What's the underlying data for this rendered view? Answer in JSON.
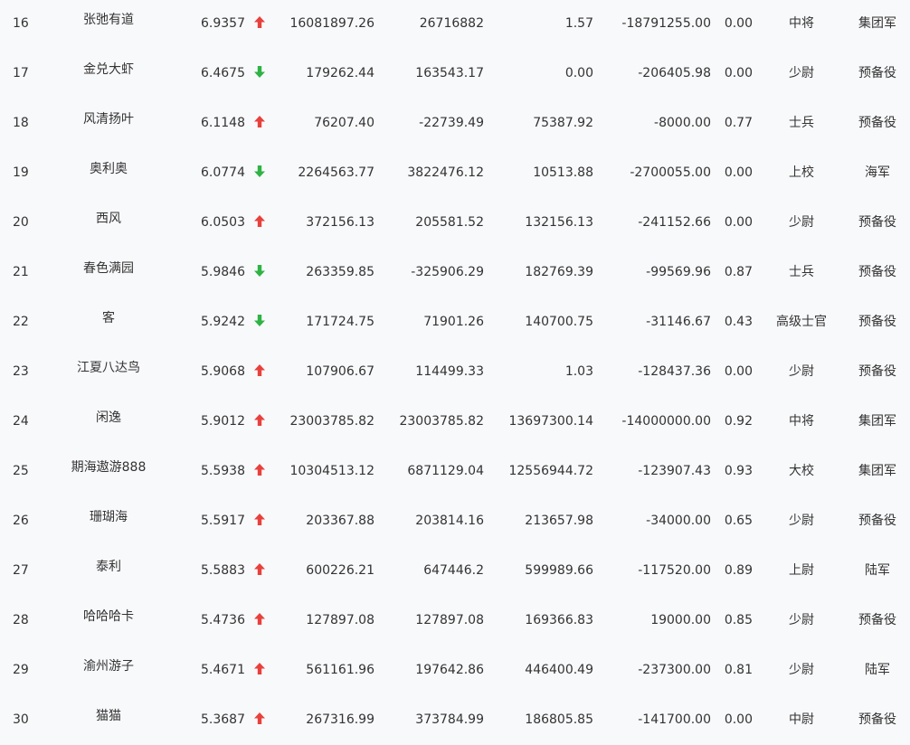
{
  "colors": {
    "up": "#e8413c",
    "down": "#2fb344",
    "text": "#333333",
    "background": "#f8f9fb"
  },
  "rows": [
    {
      "rank": "16",
      "name": "张弛有道",
      "score": "6.9357",
      "trend": "up",
      "trend_icon": "arrow-up-icon",
      "v1": "16081897.26",
      "v2": "26716882",
      "v3": "1.57",
      "v4": "-18791255.00",
      "ratio": "0.00",
      "rank_title": "中将",
      "branch": "集团军"
    },
    {
      "rank": "17",
      "name": "金兑大虾",
      "score": "6.4675",
      "trend": "down",
      "trend_icon": "arrow-down-icon",
      "v1": "179262.44",
      "v2": "163543.17",
      "v3": "0.00",
      "v4": "-206405.98",
      "ratio": "0.00",
      "rank_title": "少尉",
      "branch": "预备役"
    },
    {
      "rank": "18",
      "name": "风清扬叶",
      "score": "6.1148",
      "trend": "up",
      "trend_icon": "arrow-up-icon",
      "v1": "76207.40",
      "v2": "-22739.49",
      "v3": "75387.92",
      "v4": "-8000.00",
      "ratio": "0.77",
      "rank_title": "士兵",
      "branch": "预备役"
    },
    {
      "rank": "19",
      "name": "奥利奥",
      "score": "6.0774",
      "trend": "down",
      "trend_icon": "arrow-down-icon",
      "v1": "2264563.77",
      "v2": "3822476.12",
      "v3": "10513.88",
      "v4": "-2700055.00",
      "ratio": "0.00",
      "rank_title": "上校",
      "branch": "海军"
    },
    {
      "rank": "20",
      "name": "西风",
      "score": "6.0503",
      "trend": "up",
      "trend_icon": "arrow-up-icon",
      "v1": "372156.13",
      "v2": "205581.52",
      "v3": "132156.13",
      "v4": "-241152.66",
      "ratio": "0.00",
      "rank_title": "少尉",
      "branch": "预备役"
    },
    {
      "rank": "21",
      "name": "春色满园",
      "score": "5.9846",
      "trend": "down",
      "trend_icon": "arrow-down-icon",
      "v1": "263359.85",
      "v2": "-325906.29",
      "v3": "182769.39",
      "v4": "-99569.96",
      "ratio": "0.87",
      "rank_title": "士兵",
      "branch": "预备役"
    },
    {
      "rank": "22",
      "name": "客",
      "score": "5.9242",
      "trend": "down",
      "trend_icon": "arrow-down-icon",
      "v1": "171724.75",
      "v2": "71901.26",
      "v3": "140700.75",
      "v4": "-31146.67",
      "ratio": "0.43",
      "rank_title": "高级士官",
      "branch": "预备役"
    },
    {
      "rank": "23",
      "name": "江夏八达鸟",
      "score": "5.9068",
      "trend": "up",
      "trend_icon": "arrow-up-icon",
      "v1": "107906.67",
      "v2": "114499.33",
      "v3": "1.03",
      "v4": "-128437.36",
      "ratio": "0.00",
      "rank_title": "少尉",
      "branch": "预备役"
    },
    {
      "rank": "24",
      "name": "闲逸",
      "score": "5.9012",
      "trend": "up",
      "trend_icon": "arrow-up-icon",
      "v1": "23003785.82",
      "v2": "23003785.82",
      "v3": "13697300.14",
      "v4": "-14000000.00",
      "ratio": "0.92",
      "rank_title": "中将",
      "branch": "集团军"
    },
    {
      "rank": "25",
      "name": "期海遨游888",
      "score": "5.5938",
      "trend": "up",
      "trend_icon": "arrow-up-icon",
      "v1": "10304513.12",
      "v2": "6871129.04",
      "v3": "12556944.72",
      "v4": "-123907.43",
      "ratio": "0.93",
      "rank_title": "大校",
      "branch": "集团军"
    },
    {
      "rank": "26",
      "name": "珊瑚海",
      "score": "5.5917",
      "trend": "up",
      "trend_icon": "arrow-up-icon",
      "v1": "203367.88",
      "v2": "203814.16",
      "v3": "213657.98",
      "v4": "-34000.00",
      "ratio": "0.65",
      "rank_title": "少尉",
      "branch": "预备役"
    },
    {
      "rank": "27",
      "name": "泰利",
      "score": "5.5883",
      "trend": "up",
      "trend_icon": "arrow-up-icon",
      "v1": "600226.21",
      "v2": "647446.2",
      "v3": "599989.66",
      "v4": "-117520.00",
      "ratio": "0.89",
      "rank_title": "上尉",
      "branch": "陆军"
    },
    {
      "rank": "28",
      "name": "哈哈哈卡",
      "score": "5.4736",
      "trend": "up",
      "trend_icon": "arrow-up-icon",
      "v1": "127897.08",
      "v2": "127897.08",
      "v3": "169366.83",
      "v4": "19000.00",
      "ratio": "0.85",
      "rank_title": "少尉",
      "branch": "预备役"
    },
    {
      "rank": "29",
      "name": "渝州游子",
      "score": "5.4671",
      "trend": "up",
      "trend_icon": "arrow-up-icon",
      "v1": "561161.96",
      "v2": "197642.86",
      "v3": "446400.49",
      "v4": "-237300.00",
      "ratio": "0.81",
      "rank_title": "少尉",
      "branch": "陆军"
    },
    {
      "rank": "30",
      "name": "猫猫",
      "score": "5.3687",
      "trend": "up",
      "trend_icon": "arrow-up-icon",
      "v1": "267316.99",
      "v2": "373784.99",
      "v3": "186805.85",
      "v4": "-141700.00",
      "ratio": "0.00",
      "rank_title": "中尉",
      "branch": "预备役"
    }
  ]
}
